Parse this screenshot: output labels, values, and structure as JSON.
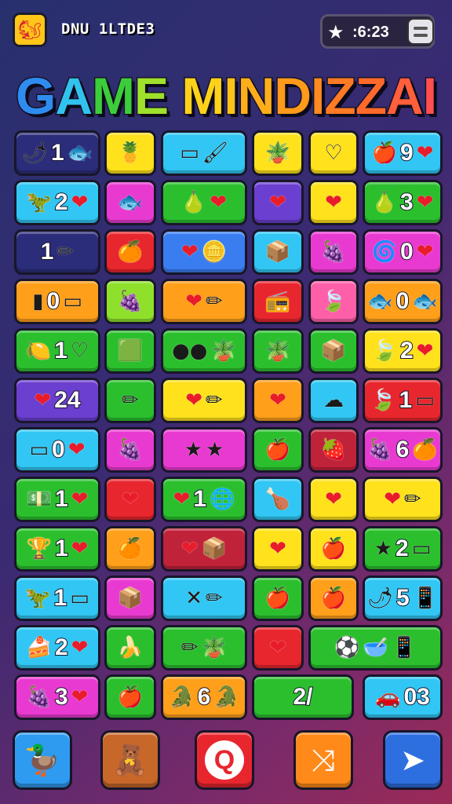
{
  "header": {
    "logo_icon": "squirrel-icon",
    "title": "DNU 1LTDE3",
    "timer_icon": "star-icon",
    "timer": " :6:23",
    "menu_icon": "menu-icon"
  },
  "game_title": {
    "letters": [
      {
        "ch": "G",
        "color": "#2e8bf0"
      },
      {
        "ch": "A",
        "color": "#31c3ee"
      },
      {
        "ch": "M",
        "color": "#3ccd3a"
      },
      {
        "ch": "E",
        "color": "#9ee02b"
      },
      {
        "ch": " ",
        "color": "#ffffff"
      },
      {
        "ch": "M",
        "color": "#ffd21a"
      },
      {
        "ch": "I",
        "color": "#ffc21a"
      },
      {
        "ch": "N",
        "color": "#ffae1a"
      },
      {
        "ch": "D",
        "color": "#ff9a1a"
      },
      {
        "ch": "I",
        "color": "#ff8a1f"
      },
      {
        "ch": "Z",
        "color": "#ff7a24"
      },
      {
        "ch": "Z",
        "color": "#ff6a2a"
      },
      {
        "ch": "A",
        "color": "#ff5f3a"
      },
      {
        "ch": "I",
        "color": "#ff4f4f"
      }
    ]
  },
  "palette": {
    "navy": "#2b2d7a",
    "yellow": "#ffe11c",
    "cyan": "#31c6f3",
    "orange": "#ff9f1a",
    "red": "#e8262e",
    "green": "#2bbf2e",
    "lime": "#8ee02b",
    "magenta": "#e83ad0",
    "purple": "#6b3fcf",
    "blue": "#3a7df0",
    "pink": "#ff5fa8",
    "crimson": "#c0223a"
  },
  "rows": [
    [
      {
        "color": "navy",
        "icons": [
          "chili-icon"
        ],
        "text": "1",
        "icons_after": [
          "fish-icon"
        ]
      },
      {
        "color": "yellow",
        "icons": [
          "pineapple-icon"
        ],
        "text": ""
      },
      {
        "color": "cyan",
        "icons": [
          "flag-icon",
          "brush-icon"
        ],
        "text": ""
      },
      {
        "color": "yellow",
        "icons": [
          "pot-plant-icon"
        ],
        "text": ""
      },
      {
        "color": "yellow",
        "icons": [
          "heart-outline-icon"
        ],
        "text": ""
      },
      {
        "color": "cyan",
        "icons": [
          "apple-icon"
        ],
        "text": "9",
        "icons_after": [
          "heart-icon"
        ]
      }
    ],
    [
      {
        "color": "cyan",
        "icons": [
          "dino-icon"
        ],
        "text": "2",
        "icons_after": [
          "heart-icon"
        ]
      },
      {
        "color": "magenta",
        "icons": [
          "fish-icon"
        ],
        "text": ""
      },
      {
        "color": "green",
        "icons": [
          "pear-icon",
          "heart-icon"
        ],
        "text": ""
      },
      {
        "color": "purple",
        "icons": [
          "heart-icon"
        ],
        "text": ""
      },
      {
        "color": "yellow",
        "icons": [
          "heart-icon"
        ],
        "text": ""
      },
      {
        "color": "green",
        "icons": [
          "pear-icon"
        ],
        "text": "3",
        "icons_after": [
          "heart-icon"
        ]
      }
    ],
    [
      {
        "color": "navy",
        "icons": [],
        "text": "1",
        "icons_after": [
          "pencil-icon"
        ]
      },
      {
        "color": "red",
        "icons": [
          "orange-icon"
        ],
        "text": ""
      },
      {
        "color": "blue",
        "icons": [
          "heart-icon",
          "coins-icon"
        ],
        "text": ""
      },
      {
        "color": "cyan",
        "icons": [
          "box-icon"
        ],
        "text": ""
      },
      {
        "color": "magenta",
        "icons": [
          "plum-icon"
        ],
        "text": ""
      },
      {
        "color": "magenta",
        "icons": [
          "spiral-icon"
        ],
        "text": "0",
        "icons_after": [
          "heart-icon"
        ]
      }
    ],
    [
      {
        "color": "orange",
        "icons": [
          "block-icon"
        ],
        "text": "0",
        "icons_after": [
          "flag-icon"
        ]
      },
      {
        "color": "lime",
        "icons": [
          "plum-icon"
        ],
        "text": ""
      },
      {
        "color": "orange",
        "icons": [
          "heart-icon",
          "pencil-icon"
        ],
        "text": ""
      },
      {
        "color": "red",
        "icons": [
          "radio-icon"
        ],
        "text": ""
      },
      {
        "color": "pink",
        "icons": [
          "leaf-icon"
        ],
        "text": ""
      },
      {
        "color": "orange",
        "icons": [
          "fish-icon"
        ],
        "text": "0",
        "icons_after": [
          "fish-icon"
        ]
      }
    ],
    [
      {
        "color": "green",
        "icons": [
          "lemon-icon"
        ],
        "text": "1",
        "icons_after": [
          "heart-outline-icon"
        ]
      },
      {
        "color": "green",
        "icons": [
          "cube-icon"
        ],
        "text": ""
      },
      {
        "color": "green",
        "icons": [
          "dots-icon",
          "pot-plant-icon"
        ],
        "text": ""
      },
      {
        "color": "green",
        "icons": [
          "pot-plant-icon"
        ],
        "text": ""
      },
      {
        "color": "green",
        "icons": [
          "box-icon"
        ],
        "text": ""
      },
      {
        "color": "yellow",
        "icons": [
          "leaf-icon"
        ],
        "text": "2",
        "icons_after": [
          "heart-icon"
        ]
      }
    ],
    [
      {
        "color": "purple",
        "icons": [
          "heart-icon"
        ],
        "text": "24"
      },
      {
        "color": "green",
        "icons": [
          "pencil-icon"
        ],
        "text": ""
      },
      {
        "color": "yellow",
        "icons": [
          "heart-icon",
          "pencil-icon"
        ],
        "text": ""
      },
      {
        "color": "orange",
        "icons": [
          "heart-icon"
        ],
        "text": ""
      },
      {
        "color": "cyan",
        "icons": [
          "cloud-icon"
        ],
        "text": ""
      },
      {
        "color": "red",
        "icons": [
          "leaf-icon"
        ],
        "text": "1",
        "icons_after": [
          "flag-icon"
        ]
      }
    ],
    [
      {
        "color": "cyan",
        "icons": [
          "flag-icon"
        ],
        "text": "0",
        "icons_after": [
          "heart-icon"
        ]
      },
      {
        "color": "magenta",
        "icons": [
          "plum-icon"
        ],
        "text": ""
      },
      {
        "color": "magenta",
        "icons": [
          "star-icon",
          "star-icon"
        ],
        "text": ""
      },
      {
        "color": "green",
        "icons": [
          "apple-icon"
        ],
        "text": ""
      },
      {
        "color": "crimson",
        "icons": [
          "strawberry-icon"
        ],
        "text": ""
      },
      {
        "color": "magenta",
        "icons": [
          "grapes-icon"
        ],
        "text": "6",
        "icons_after": [
          "orange-icon"
        ]
      }
    ],
    [
      {
        "color": "green",
        "icons": [
          "money-icon"
        ],
        "text": "1",
        "icons_after": [
          "heart-icon"
        ]
      },
      {
        "color": "red",
        "icons": [
          "heart-icon"
        ],
        "text": ""
      },
      {
        "color": "green",
        "icons": [
          "heart-icon"
        ],
        "text": "1",
        "icons_after": [
          "globe-icon"
        ]
      },
      {
        "color": "cyan",
        "icons": [
          "drumstick-icon"
        ],
        "text": ""
      },
      {
        "color": "yellow",
        "icons": [
          "heart-icon"
        ],
        "text": ""
      },
      {
        "color": "yellow",
        "icons": [
          "heart-icon",
          "pencil-icon"
        ],
        "text": ""
      }
    ],
    [
      {
        "color": "green",
        "icons": [
          "cup-icon"
        ],
        "text": "1",
        "icons_after": [
          "heart-icon"
        ]
      },
      {
        "color": "orange",
        "icons": [
          "orange-icon"
        ],
        "text": ""
      },
      {
        "color": "crimson",
        "icons": [
          "heart-icon",
          "box-icon"
        ],
        "text": ""
      },
      {
        "color": "yellow",
        "icons": [
          "heart-icon"
        ],
        "text": ""
      },
      {
        "color": "yellow",
        "icons": [
          "apple-icon"
        ],
        "text": ""
      },
      {
        "color": "green",
        "icons": [
          "star-icon"
        ],
        "text": "2",
        "icons_after": [
          "flag-icon"
        ]
      }
    ],
    [
      {
        "color": "cyan",
        "icons": [
          "dino-icon"
        ],
        "text": "1",
        "icons_after": [
          "flag-icon"
        ]
      },
      {
        "color": "magenta",
        "icons": [
          "box-icon"
        ],
        "text": ""
      },
      {
        "color": "cyan",
        "icons": [
          "cross-icon",
          "pencil-icon"
        ],
        "text": ""
      },
      {
        "color": "green",
        "icons": [
          "apple-icon"
        ],
        "text": ""
      },
      {
        "color": "orange",
        "icons": [
          "apple-icon"
        ],
        "text": ""
      },
      {
        "color": "cyan",
        "icons": [
          "chili-icon"
        ],
        "text": "5",
        "icons_after": [
          "phone-icon"
        ]
      }
    ],
    [
      {
        "color": "cyan",
        "icons": [
          "cake-icon"
        ],
        "text": "2",
        "icons_after": [
          "heart-icon"
        ]
      },
      {
        "color": "green",
        "icons": [
          "banana-icon"
        ],
        "text": ""
      },
      {
        "color": "green",
        "icons": [
          "pencil-icon",
          "pot-plant-icon"
        ],
        "text": ""
      },
      {
        "color": "red",
        "icons": [
          "heart-icon"
        ],
        "text": ""
      },
      {
        "color": "green",
        "icons": [
          "ball-icon",
          "bowl-icon",
          "phone-icon"
        ],
        "text": ""
      }
    ],
    [
      {
        "color": "magenta",
        "icons": [
          "plum-icon"
        ],
        "text": "3",
        "icons_after": [
          "heart-icon"
        ]
      },
      {
        "color": "green",
        "icons": [
          "apple-icon"
        ],
        "text": ""
      },
      {
        "color": "orange",
        "icons": [
          "croc-icon"
        ],
        "text": "6",
        "icons_after": [
          "croc-icon"
        ]
      },
      {
        "color": "green",
        "icons": [],
        "text": "2/"
      },
      {
        "color": "cyan",
        "icons": [
          "car-icon"
        ],
        "text": "03"
      }
    ]
  ],
  "bottom_bar": [
    {
      "name": "hint",
      "color": "#2f9bf0",
      "icon": "duck-icon"
    },
    {
      "name": "characters",
      "color": "#c8672a",
      "icon": "characters-icon"
    },
    {
      "name": "search",
      "color": "#e8262e",
      "icon": "search-icon"
    },
    {
      "name": "shuffle",
      "color": "#ff8a1a",
      "icon": "shuffle-icon"
    },
    {
      "name": "send",
      "color": "#2e6fe0",
      "icon": "send-icon"
    }
  ]
}
